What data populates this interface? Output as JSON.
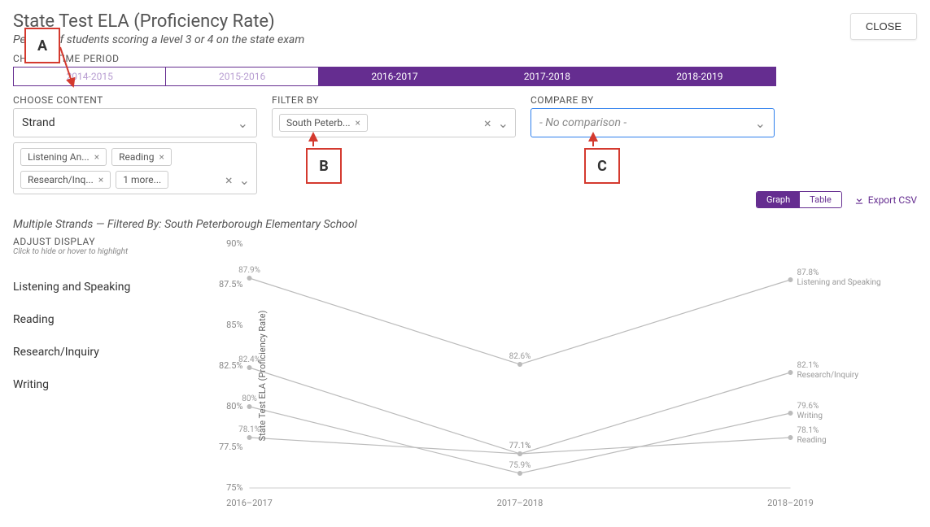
{
  "header": {
    "title": "State Test ELA (Proficiency Rate)",
    "subtitle": "Percent of students scoring a level 3 or 4 on the state exam",
    "close": "CLOSE"
  },
  "time_period": {
    "label": "CHOOSE TIME PERIOD",
    "options": [
      {
        "label": "2014-2015",
        "active": false
      },
      {
        "label": "2015-2016",
        "active": false
      },
      {
        "label": "2016-2017",
        "active": true
      },
      {
        "label": "2017-2018",
        "active": true
      },
      {
        "label": "2018-2019",
        "active": true
      }
    ]
  },
  "choose_content": {
    "label": "CHOOSE CONTENT",
    "value": "Strand",
    "tags": [
      "Listening An...",
      "Reading",
      "Research/Inq...",
      "1 more..."
    ]
  },
  "filter_by": {
    "label": "FILTER BY",
    "tags": [
      "South Peterb..."
    ]
  },
  "compare_by": {
    "label": "COMPARE BY",
    "placeholder": "- No comparison -"
  },
  "annotations": {
    "a": "A",
    "b": "B",
    "c": "C"
  },
  "summary": "Multiple Strands — Filtered By: South Peterborough Elementary School",
  "view_toggle": {
    "graph": "Graph",
    "table": "Table"
  },
  "export": "Export CSV",
  "adjust": {
    "title": "ADJUST DISPLAY",
    "sub": "Click to hide or hover to highlight"
  },
  "legend": [
    "Listening and Speaking",
    "Reading",
    "Research/Inquiry",
    "Writing"
  ],
  "chart_data": {
    "type": "line",
    "title": "State Test ELA (Proficiency Rate)",
    "xlabel": "",
    "ylabel": "State Test ELA (Proficiency Rate)",
    "ylim": [
      75,
      90
    ],
    "yticks": [
      75,
      77.5,
      80,
      82.5,
      85,
      87.5,
      90
    ],
    "categories": [
      "2016–2017",
      "2017–2018",
      "2018–2019"
    ],
    "series": [
      {
        "name": "Listening and Speaking",
        "values": [
          87.9,
          82.6,
          87.8
        ]
      },
      {
        "name": "Research/Inquiry",
        "values": [
          82.4,
          77.1,
          82.1
        ]
      },
      {
        "name": "Writing",
        "values": [
          80.0,
          75.9,
          79.6
        ]
      },
      {
        "name": "Reading",
        "values": [
          78.1,
          77.1,
          78.1
        ]
      }
    ]
  }
}
